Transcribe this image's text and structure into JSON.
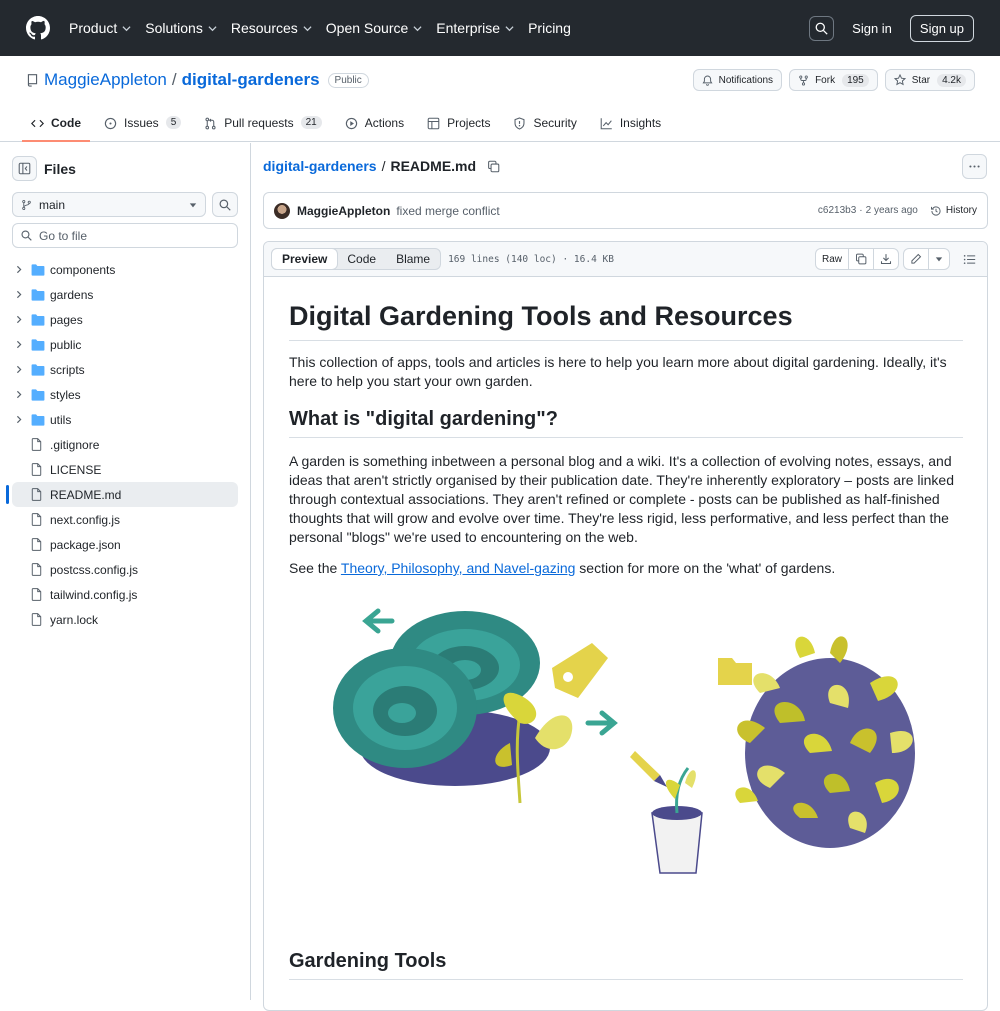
{
  "header": {
    "nav": [
      "Product",
      "Solutions",
      "Resources",
      "Open Source",
      "Enterprise",
      "Pricing"
    ],
    "sign_in": "Sign in",
    "sign_up": "Sign up"
  },
  "repo": {
    "owner": "MaggieAppleton",
    "separator": "/",
    "name": "digital-gardeners",
    "visibility": "Public",
    "notifications": "Notifications",
    "fork_label": "Fork",
    "fork_count": "195",
    "star_label": "Star",
    "star_count": "4.2k"
  },
  "tabs": [
    {
      "label": "Code",
      "count": ""
    },
    {
      "label": "Issues",
      "count": "5"
    },
    {
      "label": "Pull requests",
      "count": "21"
    },
    {
      "label": "Actions",
      "count": ""
    },
    {
      "label": "Projects",
      "count": ""
    },
    {
      "label": "Security",
      "count": ""
    },
    {
      "label": "Insights",
      "count": ""
    }
  ],
  "sidebar": {
    "title": "Files",
    "branch": "main",
    "goto_placeholder": "Go to file",
    "tree": [
      {
        "name": "components",
        "type": "folder"
      },
      {
        "name": "gardens",
        "type": "folder"
      },
      {
        "name": "pages",
        "type": "folder"
      },
      {
        "name": "public",
        "type": "folder"
      },
      {
        "name": "scripts",
        "type": "folder"
      },
      {
        "name": "styles",
        "type": "folder"
      },
      {
        "name": "utils",
        "type": "folder"
      },
      {
        "name": ".gitignore",
        "type": "file"
      },
      {
        "name": "LICENSE",
        "type": "file"
      },
      {
        "name": "README.md",
        "type": "file",
        "selected": true
      },
      {
        "name": "next.config.js",
        "type": "file"
      },
      {
        "name": "package.json",
        "type": "file"
      },
      {
        "name": "postcss.config.js",
        "type": "file"
      },
      {
        "name": "tailwind.config.js",
        "type": "file"
      },
      {
        "name": "yarn.lock",
        "type": "file"
      }
    ]
  },
  "breadcrumb": {
    "repo": "digital-gardeners",
    "sep": "/",
    "file": "README.md"
  },
  "commit": {
    "author": "MaggieAppleton",
    "message": "fixed merge conflict",
    "sha": "c6213b3",
    "dot": "·",
    "time": "2 years ago",
    "history": "History"
  },
  "filebar": {
    "modes": [
      "Preview",
      "Code",
      "Blame"
    ],
    "info": "169 lines (140 loc) · 16.4 KB",
    "raw": "Raw"
  },
  "readme": {
    "h1": "Digital Gardening Tools and Resources",
    "intro": "This collection of apps, tools and articles is here to help you learn more about digital gardening. Ideally, it's here to help you start your own garden.",
    "h2_what": "What is \"digital gardening\"?",
    "para": "A garden is something inbetween a personal blog and a wiki. It's a collection of evolving notes, essays, and ideas that aren't strictly organised by their publication date. They're inherently exploratory – posts are linked through contextual associations. They aren't refined or complete - posts can be published as half-finished thoughts that will grow and evolve over time. They're less rigid, less performative, and less perfect than the personal \"blogs\" we're used to encountering on the web.",
    "see_pre": "See the ",
    "see_link": "Theory, Philosophy, and Navel-gazing",
    "see_post": " section for more on the 'what' of gardens.",
    "h2_tools": "Gardening Tools"
  },
  "colors": {
    "header_bg": "#24292f",
    "link": "#0969da",
    "tab_underline": "#fd8c73",
    "plant_teal": "#2a8a82",
    "plant_yellow": "#d9d63a"
  }
}
